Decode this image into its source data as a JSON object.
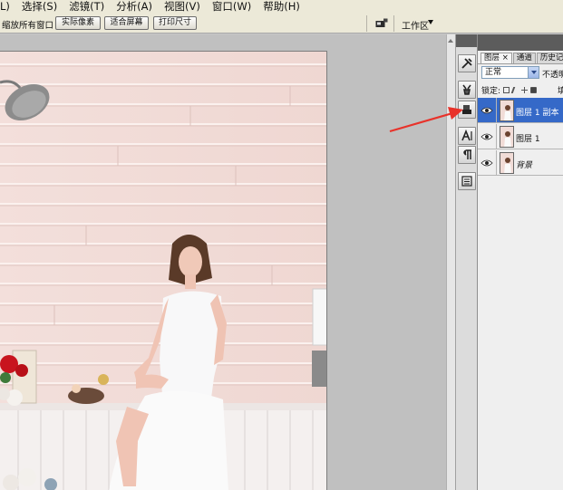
{
  "menu": [
    "L)",
    "选择(S)",
    "滤镜(T)",
    "分析(A)",
    "视图(V)",
    "窗口(W)",
    "帮助(H)"
  ],
  "options_bar": {
    "zoom_all_label": "缩放所有窗口",
    "buttons": [
      "实际像素",
      "适合屏幕",
      "打印尺寸"
    ],
    "workspace_label": "工作区"
  },
  "layers_panel": {
    "tabs": [
      "图层 ×",
      "通道",
      "历史记"
    ],
    "blend_mode": "正常",
    "opacity_label": "不透明",
    "lock_label": "锁定:",
    "fill_label": "填",
    "layers": [
      {
        "name": "图层 1 副本",
        "selected": true,
        "visible": true
      },
      {
        "name": "图层 1",
        "selected": false,
        "visible": true
      },
      {
        "name": "背景",
        "selected": false,
        "visible": true
      }
    ]
  },
  "colors": {
    "menu_bg": "#ece9d8",
    "selection": "#3569c8",
    "annotation_arrow": "#e8322a",
    "wall": "#f1dcd7"
  },
  "icons": [
    "workspace-icon",
    "tool-preset-icon",
    "brush-icon",
    "clone-source-icon",
    "character-icon",
    "paragraph-icon",
    "layer-comps-icon",
    "eye-icon",
    "lock-icon"
  ]
}
